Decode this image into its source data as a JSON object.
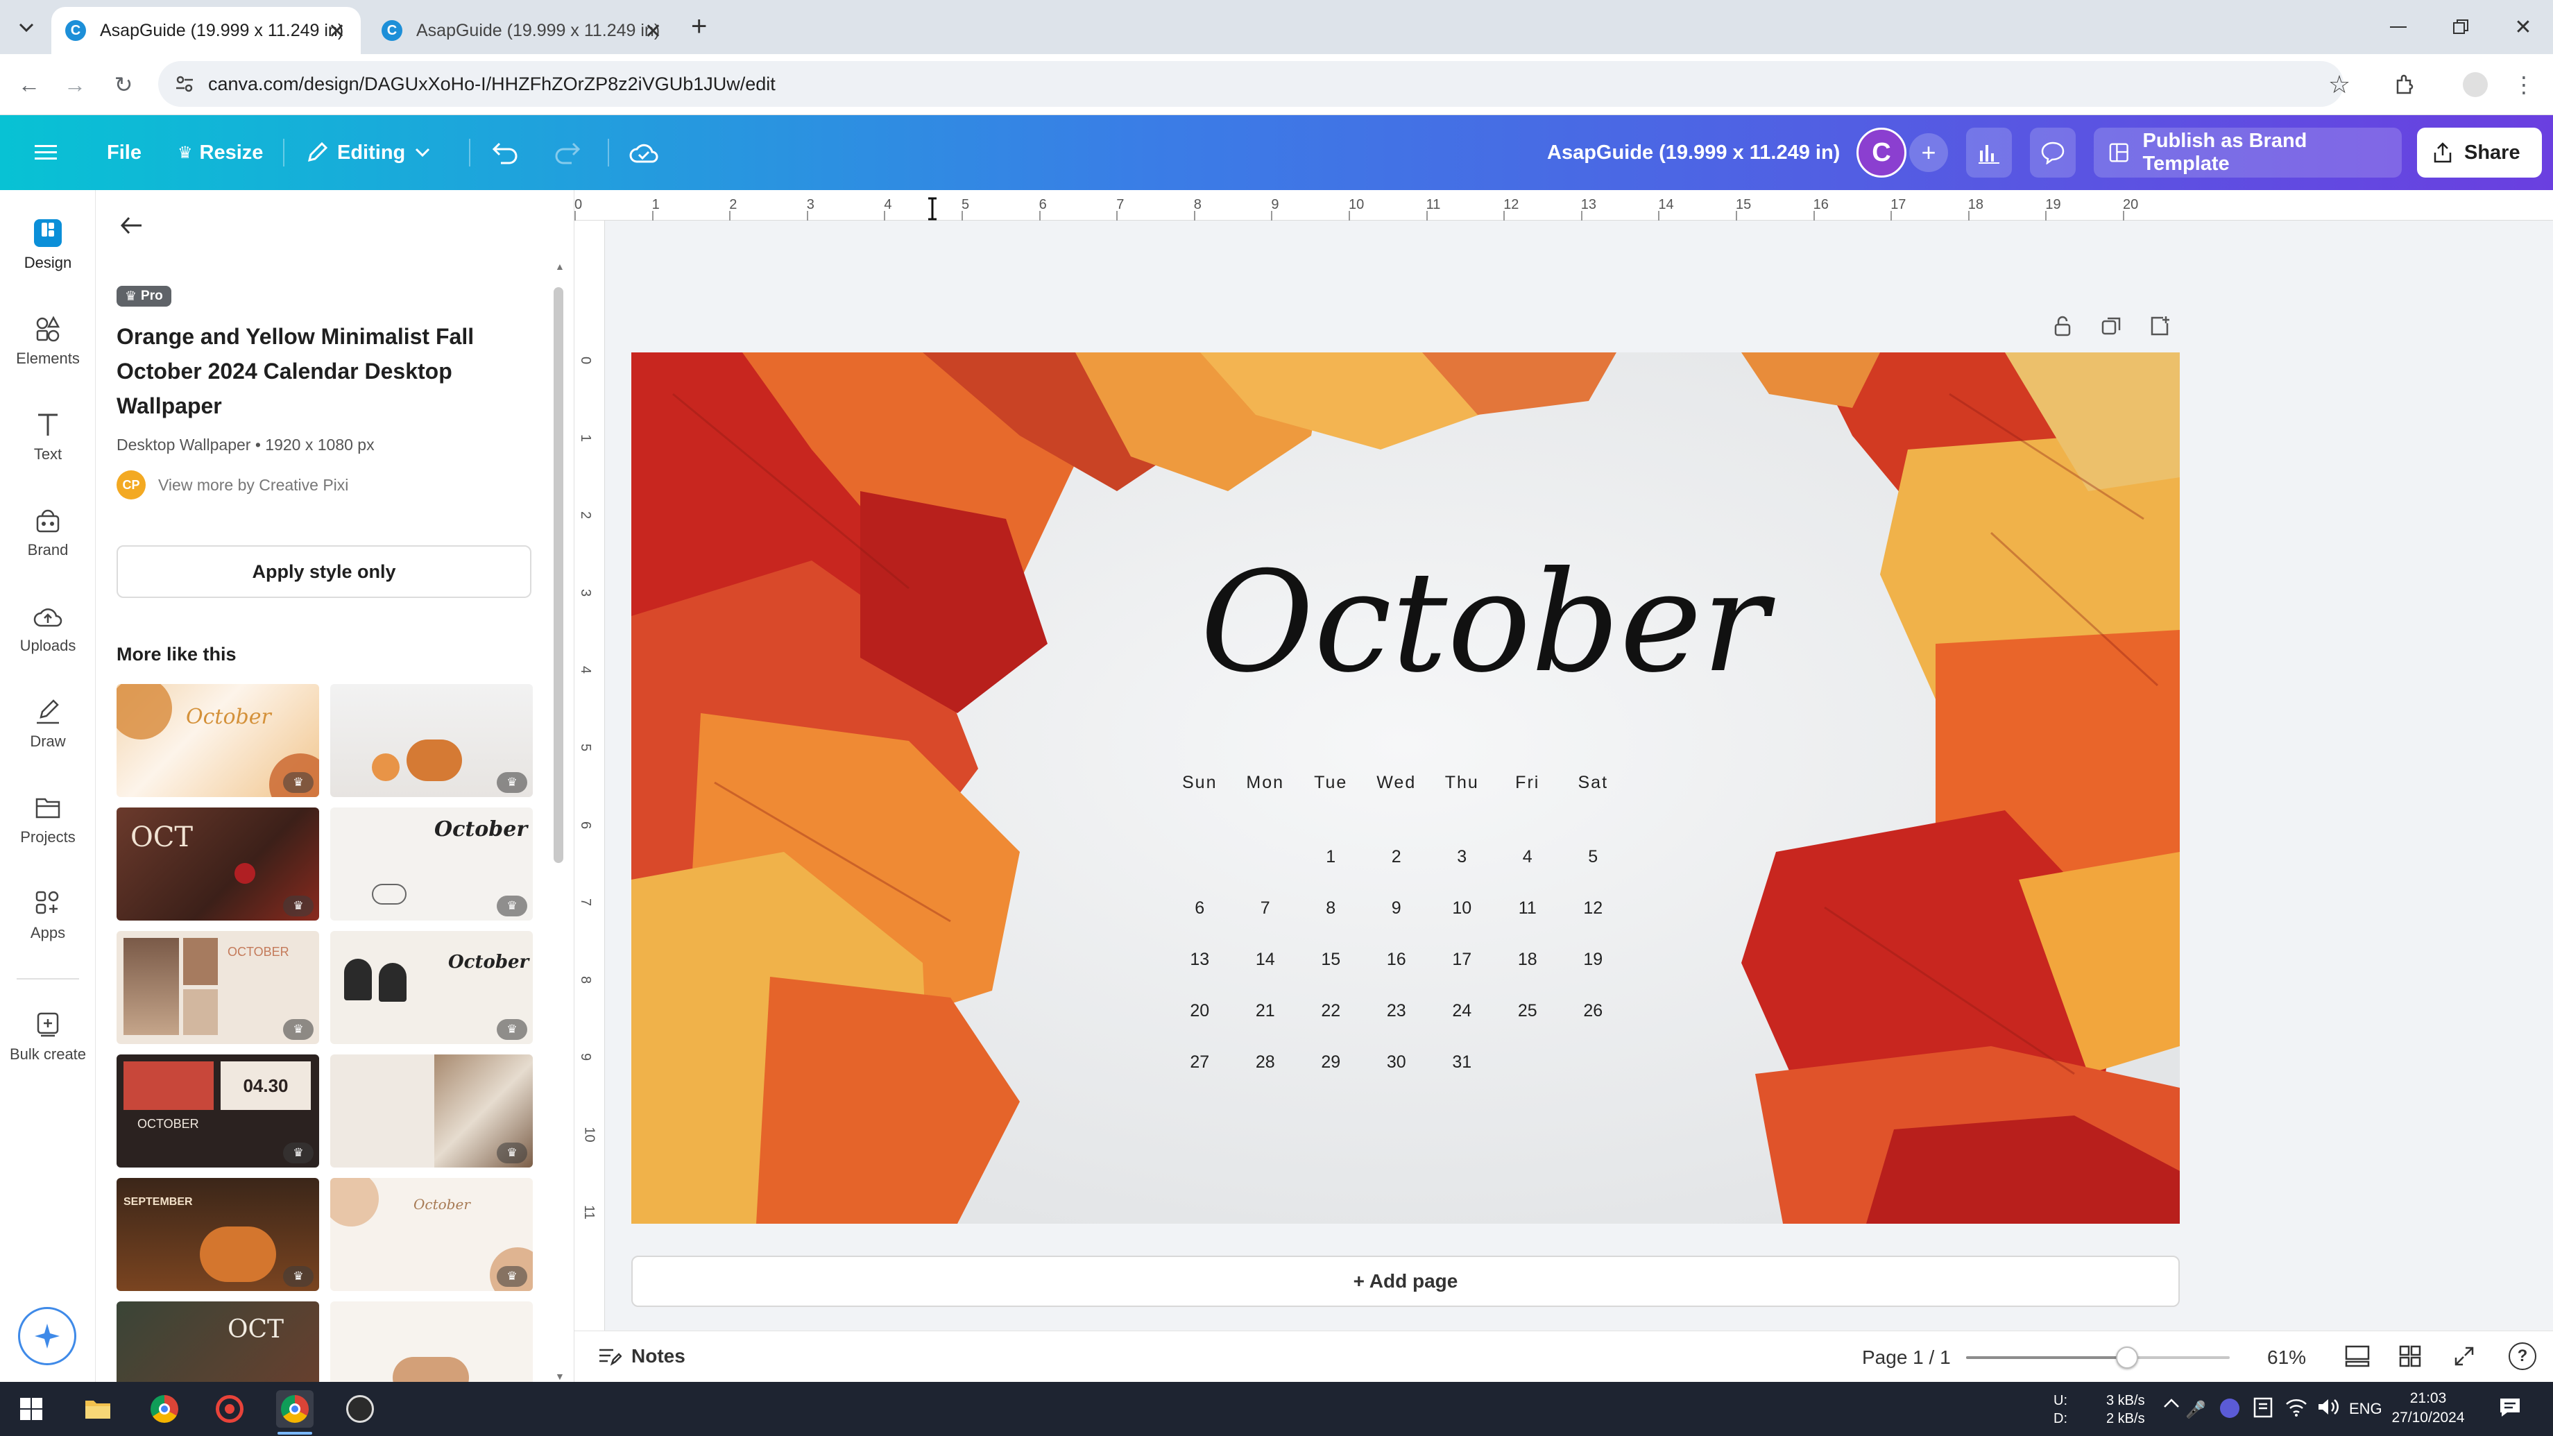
{
  "browser": {
    "tabs": [
      {
        "label": "AsapGuide (19.999 x 11.249 in)",
        "active": true
      },
      {
        "label": "AsapGuide (19.999 x 11.249 in)",
        "active": false
      }
    ],
    "url": "canva.com/design/DAGUxXoHo-I/HHZFhZOrZP8z2iVGUb1JUw/edit"
  },
  "header": {
    "file": "File",
    "resize": "Resize",
    "editing": "Editing",
    "doc_title": "AsapGuide (19.999 x 11.249 in)",
    "avatar_letter": "C",
    "publish": "Publish as Brand Template",
    "share": "Share"
  },
  "rail": [
    {
      "label": "Design",
      "icon": "design-icon"
    },
    {
      "label": "Elements",
      "icon": "elements-icon"
    },
    {
      "label": "Text",
      "icon": "text-icon"
    },
    {
      "label": "Brand",
      "icon": "brand-icon"
    },
    {
      "label": "Uploads",
      "icon": "uploads-icon"
    },
    {
      "label": "Draw",
      "icon": "draw-icon"
    },
    {
      "label": "Projects",
      "icon": "projects-icon"
    },
    {
      "label": "Apps",
      "icon": "apps-icon"
    },
    {
      "label": "Bulk create",
      "icon": "bulk-create-icon"
    }
  ],
  "panel": {
    "badge": "Pro",
    "title": "Orange and Yellow Minimalist Fall October 2024 Calendar Desktop Wallpaper",
    "title_lines": [
      "Orange and Yellow Minimalist Fall",
      "October 2024 Calendar Desktop",
      "Wallpaper"
    ],
    "meta": "Desktop Wallpaper • 1920 x 1080 px",
    "creator_initials": "CP",
    "creator_link": "View more by Creative Pixi",
    "apply_button": "Apply style only",
    "more_title": "More like this",
    "thumb_texts": [
      "October",
      "OCT",
      "October",
      "OCTOBER",
      "04.30",
      "OCTOBER",
      "SEPTEMBER",
      "October",
      "OCT"
    ]
  },
  "ruler": {
    "h": [
      "0",
      "1",
      "2",
      "3",
      "4",
      "5",
      "6",
      "7",
      "8",
      "9",
      "10",
      "11",
      "12",
      "13",
      "14",
      "15",
      "16",
      "17",
      "18",
      "19",
      "20"
    ],
    "v": [
      "0",
      "1",
      "2",
      "3",
      "4",
      "5",
      "6",
      "7",
      "8",
      "9",
      "10",
      "11"
    ]
  },
  "calendar": {
    "month": "October",
    "weekdays": [
      "Sun",
      "Mon",
      "Tue",
      "Wed",
      "Thu",
      "Fri",
      "Sat"
    ],
    "weeks": [
      [
        "",
        "",
        "1",
        "2",
        "3",
        "4",
        "5"
      ],
      [
        "6",
        "7",
        "8",
        "9",
        "10",
        "11",
        "12"
      ],
      [
        "13",
        "14",
        "15",
        "16",
        "17",
        "18",
        "19"
      ],
      [
        "20",
        "21",
        "22",
        "23",
        "24",
        "25",
        "26"
      ],
      [
        "27",
        "28",
        "29",
        "30",
        "31",
        "",
        ""
      ]
    ]
  },
  "canvas": {
    "add_page": "+ Add page"
  },
  "bottom": {
    "notes": "Notes",
    "page": "Page 1 / 1",
    "zoom": "61%",
    "zoom_fraction": 0.61
  },
  "taskbar": {
    "net_up_label": "U:",
    "net_down_label": "D:",
    "net_up": "3 kB/s",
    "net_down": "2 kB/s",
    "lang": "ENG",
    "time": "21:03",
    "date": "27/10/2024"
  },
  "colors": {
    "header_start": "#08c2d4",
    "header_end": "#6a3fe0",
    "avatar": "#8b3fd0",
    "leaf_red": "#c8261f",
    "leaf_orange": "#e9652a",
    "leaf_yellow": "#f0b24a"
  }
}
